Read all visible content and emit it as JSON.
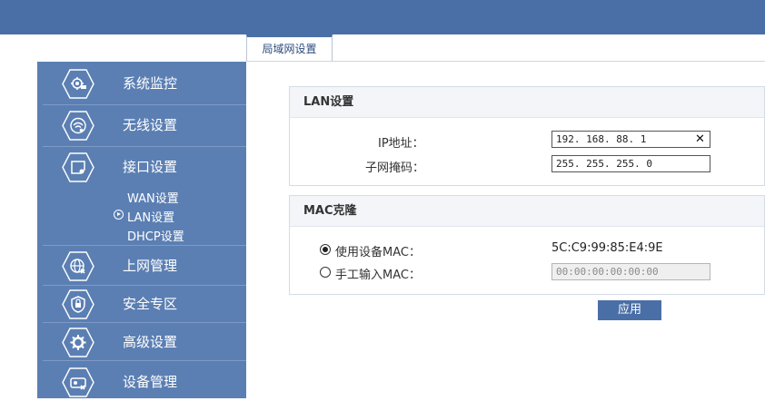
{
  "tab": {
    "label": "局域网设置"
  },
  "sidebar": {
    "items": [
      {
        "label": "系统监控",
        "icon": "gear-monitor-icon"
      },
      {
        "label": "无线设置",
        "icon": "wifi-icon"
      },
      {
        "label": "接口设置",
        "icon": "interface-icon"
      },
      {
        "label": "上网管理",
        "icon": "globe-icon"
      },
      {
        "label": "安全专区",
        "icon": "shield-lock-icon"
      },
      {
        "label": "高级设置",
        "icon": "gear-icon"
      },
      {
        "label": "设备管理",
        "icon": "device-icon"
      }
    ],
    "subitems": [
      {
        "label": "WAN设置"
      },
      {
        "label": "LAN设置",
        "active": true
      },
      {
        "label": "DHCP设置"
      }
    ]
  },
  "lan": {
    "title": "LAN设置",
    "ip_label": "IP地址：",
    "ip_value": "192. 168. 88. 1",
    "mask_label": "子网掩码：",
    "mask_value": "255. 255. 255. 0"
  },
  "mac": {
    "title": "MAC克隆",
    "use_device_label": "使用设备MAC：",
    "device_mac": "5C:C9:99:85:E4:9E",
    "manual_label": "手工输入MAC：",
    "manual_placeholder": "00:00:00:00:00:00"
  },
  "apply_label": "应用",
  "colors": {
    "header": "#4a6fa6",
    "sidebar": "#5b7fb3"
  }
}
